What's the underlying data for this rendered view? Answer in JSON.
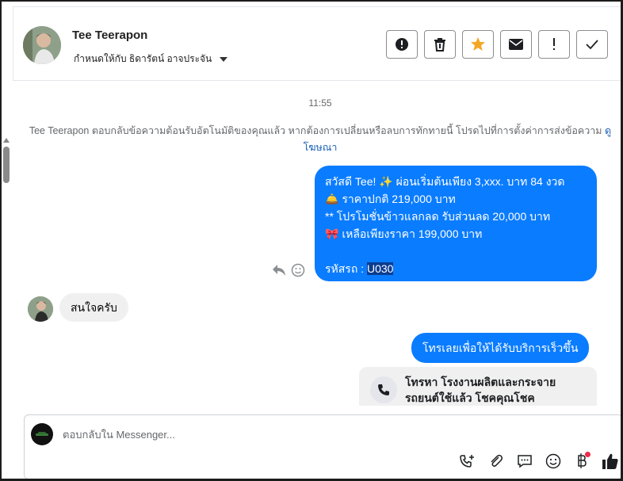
{
  "header": {
    "contact_name": "Tee Teerapon",
    "assign_label": "กำหนดให้กับ ธิดารัตน์ อาจประจัน",
    "actions": [
      {
        "name": "spam-button",
        "icon": "alert-circle-icon"
      },
      {
        "name": "delete-button",
        "icon": "trash-icon"
      },
      {
        "name": "star-button",
        "icon": "star-icon",
        "color": "#f5a623"
      },
      {
        "name": "mark-unread-button",
        "icon": "envelope-icon"
      },
      {
        "name": "follow-up-button",
        "icon": "exclamation-icon"
      },
      {
        "name": "done-button",
        "icon": "check-icon"
      }
    ]
  },
  "chat": {
    "timestamp": "11:55",
    "notice_text": "Tee Teerapon ตอบกลับข้อความต้อนรับอัตโนมัติของคุณแล้ว หากต้องการเปลี่ยนหรือลบการทักทายนี้ โปรดไปที่การตั้งค่าการส่งข้อความ",
    "notice_link": "ดูโฆษณา",
    "outgoing_message": {
      "line1": "สวัสดี Tee! ✨  ผ่อนเริ่มต้นเพียง 3,xxx. บาท 84 งวด",
      "line2": "🛎️ ราคาปกติ  219,000 บาท",
      "line3": "** โปรโมชั่นข้าวแลกลด รับส่วนลด 20,000 บาท",
      "line4": "🎀  เหลือเพียงราคา 199,000 บาท",
      "code_label": "รหัสรถ : ",
      "code_value": "U030"
    },
    "incoming_message": "สนใจครับ",
    "cta_message": "โทรเลยเพื่อให้ได้รับบริการเร็วขึ้น",
    "call_card": "โทรหา โรงงานผลิตและกระจายรถยนต์ใช้แล้ว โชคคุณโชค"
  },
  "composer": {
    "placeholder": "ตอบกลับใน Messenger...",
    "value": ""
  },
  "colors": {
    "accent": "#0a7cff",
    "incoming_bubble": "#f0f0f0",
    "badge": "#f02849"
  }
}
